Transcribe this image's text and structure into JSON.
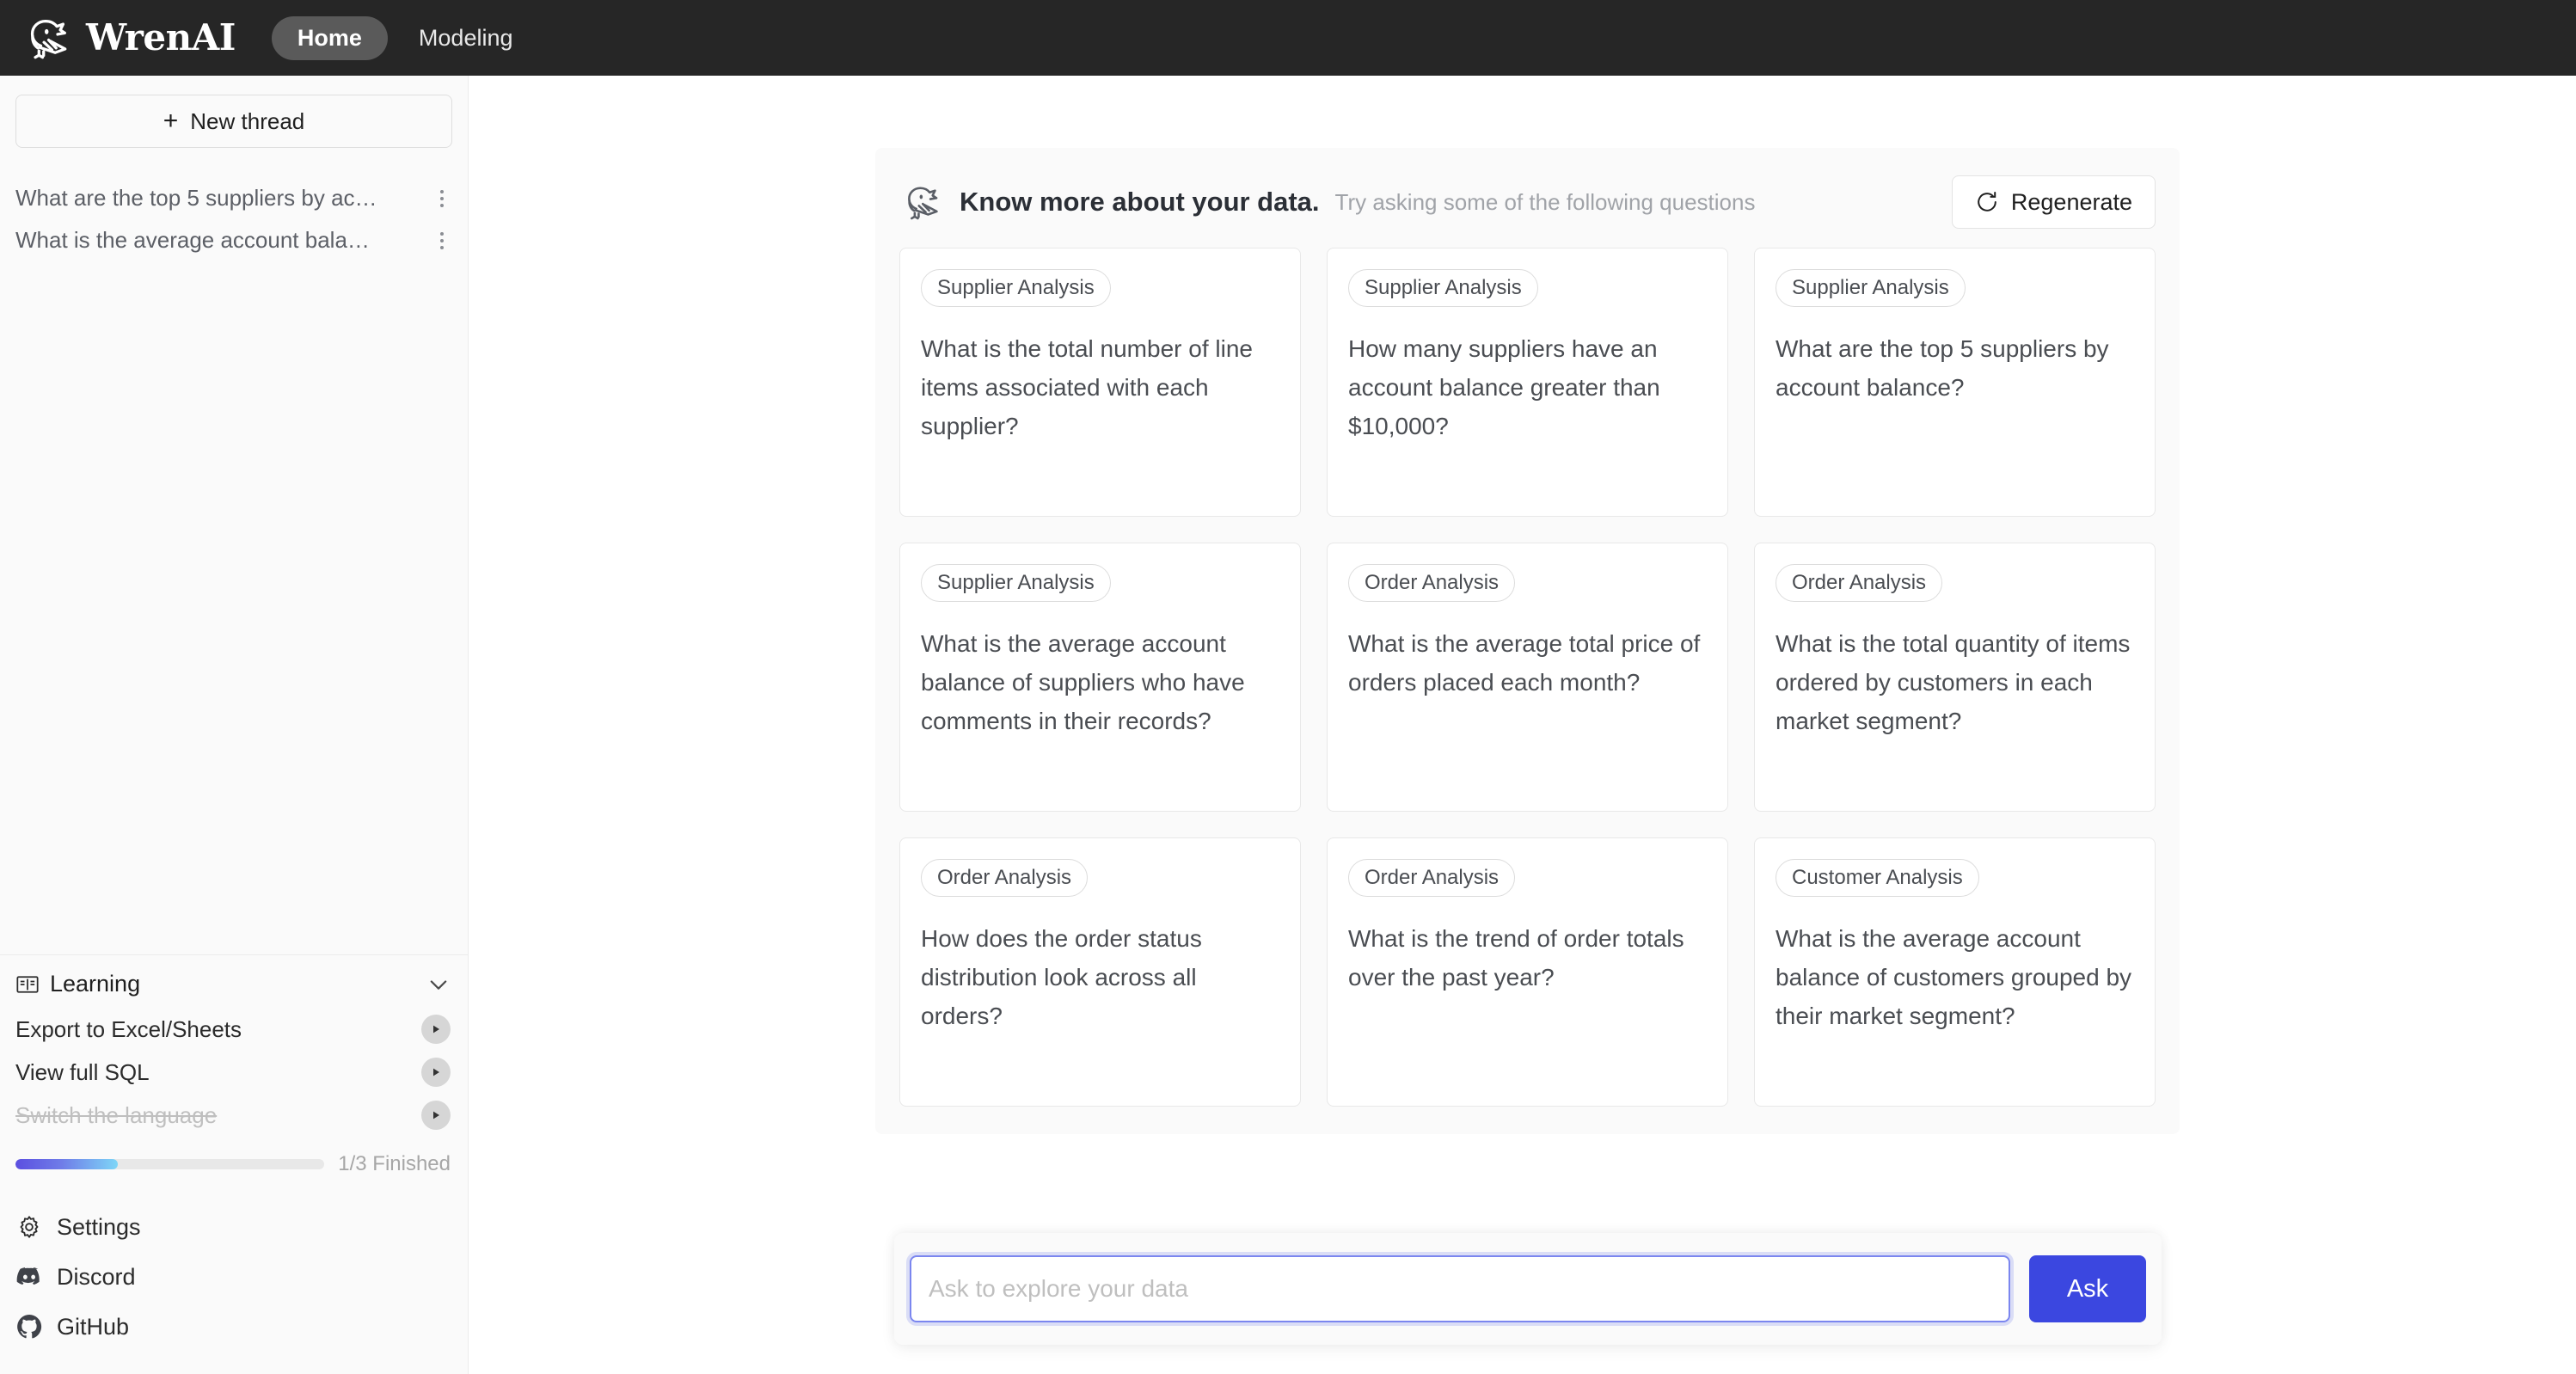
{
  "topbar": {
    "brand_name": "WrenAI",
    "logo_icon": "wren-bird-logo",
    "tabs": [
      {
        "label": "Home",
        "active": true
      },
      {
        "label": "Modeling",
        "active": false
      }
    ]
  },
  "sidebar": {
    "new_thread_label": "New thread",
    "new_thread_icon": "plus-icon",
    "threads": [
      {
        "title": "What are the top 5 suppliers by ac…",
        "menu_icon": "more-vertical-icon"
      },
      {
        "title": "What is the average account bala…",
        "menu_icon": "more-vertical-icon"
      }
    ],
    "learning": {
      "title": "Learning",
      "icon": "book-icon",
      "collapse_icon": "chevron-down-icon",
      "items": [
        {
          "label": "Export to Excel/Sheets",
          "done": false,
          "play_icon": "play-circle-icon"
        },
        {
          "label": "View full SQL",
          "done": false,
          "play_icon": "play-circle-icon"
        },
        {
          "label": "Switch the language",
          "done": true,
          "play_icon": "play-circle-icon"
        }
      ],
      "progress_label": "1/3 Finished",
      "progress_percent": 33,
      "progress_gradient_start": "#5b4fe0",
      "progress_gradient_end": "#7ed6f7"
    },
    "bottom_nav": [
      {
        "label": "Settings",
        "icon": "gear-icon"
      },
      {
        "label": "Discord",
        "icon": "discord-icon"
      },
      {
        "label": "GitHub",
        "icon": "github-icon"
      }
    ]
  },
  "main": {
    "panel": {
      "bird_icon": "wren-bird-icon",
      "title": "Know more about your data.",
      "subtitle": "Try asking some of the following questions",
      "regenerate_label": "Regenerate",
      "regenerate_icon": "refresh-icon"
    },
    "cards": [
      {
        "tag": "Supplier Analysis",
        "question": "What is the total number of line items associated with each supplier?"
      },
      {
        "tag": "Supplier Analysis",
        "question": "How many suppliers have an account balance greater than $10,000?"
      },
      {
        "tag": "Supplier Analysis",
        "question": "What are the top 5 suppliers by account balance?"
      },
      {
        "tag": "Supplier Analysis",
        "question": "What is the average account balance of suppliers who have comments in their records?"
      },
      {
        "tag": "Order Analysis",
        "question": "What is the average total price of orders placed each month?"
      },
      {
        "tag": "Order Analysis",
        "question": "What is the total quantity of items ordered by customers in each market segment?"
      },
      {
        "tag": "Order Analysis",
        "question": "How does the order status distribution look across all orders?"
      },
      {
        "tag": "Order Analysis",
        "question": "What is the trend of order totals over the past year?"
      },
      {
        "tag": "Customer Analysis",
        "question": "What is the average account balance of customers grouped by their market segment?"
      }
    ],
    "ask": {
      "placeholder": "Ask to explore your data",
      "value": "",
      "button_label": "Ask",
      "accent_color": "#3b47e0"
    }
  }
}
